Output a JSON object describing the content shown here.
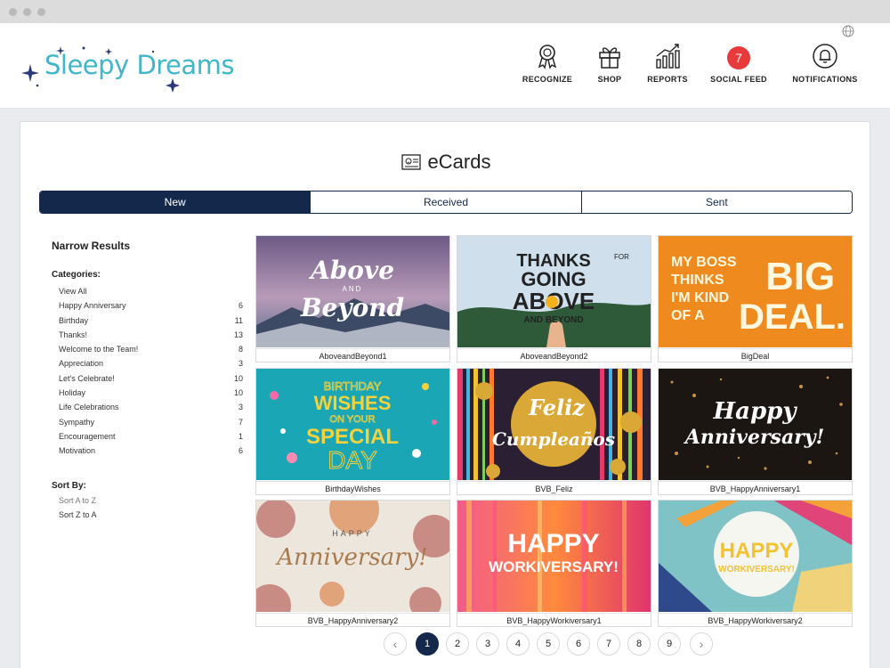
{
  "brand": {
    "name": "Sleepy Dreams",
    "color": "#3fb6c9",
    "star_color": "#2b3a7a"
  },
  "nav": {
    "recognize": "RECOGNIZE",
    "shop": "SHOP",
    "reports": "REPORTS",
    "social_feed": "SOCIAL FEED",
    "social_feed_count": "7",
    "notifications": "NOTIFICATIONS"
  },
  "page": {
    "title": "eCards"
  },
  "tabs": [
    {
      "label": "New",
      "active": true
    },
    {
      "label": "Received",
      "active": false
    },
    {
      "label": "Sent",
      "active": false
    }
  ],
  "sidebar": {
    "heading": "Narrow Results",
    "categories_label": "Categories:",
    "categories": [
      {
        "name": "View All",
        "count": ""
      },
      {
        "name": "Happy Anniversary",
        "count": "6"
      },
      {
        "name": "Birthday",
        "count": "11"
      },
      {
        "name": "Thanks!",
        "count": "13"
      },
      {
        "name": "Welcome to the Team!",
        "count": "8"
      },
      {
        "name": "Appreciation",
        "count": "3"
      },
      {
        "name": "Let's Celebrate!",
        "count": "10"
      },
      {
        "name": "Holiday",
        "count": "10"
      },
      {
        "name": "Life Celebrations",
        "count": "3"
      },
      {
        "name": "Sympathy",
        "count": "7"
      },
      {
        "name": "Encouragement",
        "count": "1"
      },
      {
        "name": "Motivation",
        "count": "6"
      }
    ],
    "sort_label": "Sort By:",
    "sort_options": [
      "Sort A to Z",
      "Sort Z to A"
    ]
  },
  "cards": [
    {
      "caption": "AboveandBeyond1",
      "art": [
        "Above",
        "AND",
        "Beyond"
      ]
    },
    {
      "caption": "AboveandBeyond2",
      "art": [
        "THANKS",
        "FOR",
        "GOING",
        "ABOVE",
        "AND BEYOND"
      ]
    },
    {
      "caption": "BigDeal",
      "art": [
        "MY BOSS",
        "THINKS",
        "I'M KIND",
        "OF A",
        "BIG",
        "DEAL."
      ]
    },
    {
      "caption": "BirthdayWishes",
      "art": [
        "BIRTHDAY",
        "WISHES",
        "ON YOUR",
        "SPECIAL",
        "DAY"
      ]
    },
    {
      "caption": "BVB_Feliz",
      "art": [
        "Feliz",
        "Cumpleaños"
      ]
    },
    {
      "caption": "BVB_HappyAnniversary1",
      "art": [
        "Happy",
        "Anniversary!"
      ]
    },
    {
      "caption": "BVB_HappyAnniversary2",
      "art": [
        "HAPPY",
        "Anniversary!"
      ]
    },
    {
      "caption": "BVB_HappyWorkiversary1",
      "art": [
        "HAPPY",
        "WORKIVERSARY!"
      ]
    },
    {
      "caption": "BVB_HappyWorkiversary2",
      "art": [
        "HAPPY",
        "WORKIVERSARY!"
      ]
    }
  ],
  "pagination": {
    "prev": "‹",
    "next": "›",
    "pages": [
      "1",
      "2",
      "3",
      "4",
      "5",
      "6",
      "7",
      "8",
      "9"
    ],
    "current": "1"
  },
  "colors": {
    "navy": "#14284b",
    "badge_red": "#e83a3a"
  }
}
